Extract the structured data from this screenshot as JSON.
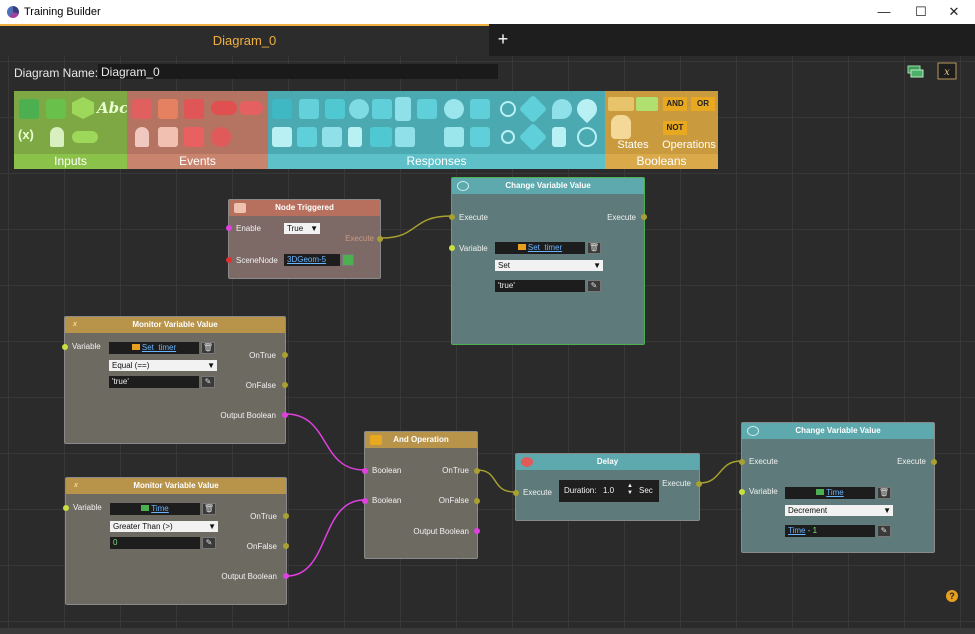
{
  "window": {
    "title": "Training Builder",
    "minimize": "—",
    "maximize": "☐",
    "close": "✕"
  },
  "tabs": [
    {
      "label": "Diagram_0"
    }
  ],
  "add_tab": "+",
  "diagram": {
    "name_label": "Diagram Name:",
    "name_value": "Diagram_0"
  },
  "palette": {
    "inputs": {
      "label": "Inputs",
      "color": "#8bc34a",
      "body": "#7da843"
    },
    "events": {
      "label": "Events",
      "color": "#c9846e",
      "body": "#b57362"
    },
    "responses": {
      "label": "Responses",
      "color": "#5ec0c8",
      "body": "#4aa9b1"
    },
    "booleans": {
      "label": "Booleans",
      "color": "#d9a94a",
      "body": "#c99a3e"
    },
    "states_label": "States",
    "operations_label": "Operations",
    "input_texts": [
      "Abc",
      "(x)"
    ],
    "bool_texts": [
      "AND",
      "OR",
      "NOT"
    ]
  },
  "nodes": {
    "node_triggered": {
      "title": "Node Triggered",
      "enable_label": "Enable",
      "enable_value": "True",
      "scenenode_label": "SceneNode",
      "scenenode_value": "3DGeom-5",
      "execute_out": "Execute"
    },
    "change_var_1": {
      "title": "Change Variable Value",
      "execute_in": "Execute",
      "execute_out": "Execute",
      "variable_label": "Variable",
      "variable_value": "Set_timer",
      "mode": "Set",
      "value": "'true'"
    },
    "monitor_1": {
      "title": "Monitor Variable Value",
      "variable_label": "Variable",
      "variable_value": "Set_timer",
      "compare": "Equal (==)",
      "value": "'true'",
      "on_true": "OnTrue",
      "on_false": "OnFalse",
      "output": "Output Boolean"
    },
    "monitor_2": {
      "title": "Monitor Variable Value",
      "variable_label": "Variable",
      "variable_value": "Time",
      "compare": "Greater Than (>)",
      "value": "0",
      "on_true": "OnTrue",
      "on_false": "OnFalse",
      "output": "Output Boolean"
    },
    "and_op": {
      "title": "And Operation",
      "in1": "Boolean",
      "in2": "Boolean",
      "on_true": "OnTrue",
      "on_false": "OnFalse",
      "output": "Output Boolean"
    },
    "delay": {
      "title": "Delay",
      "execute_in": "Execute",
      "execute_out": "Execute",
      "duration_label": "Duration:",
      "duration_value": "1.0",
      "unit": "Sec"
    },
    "change_var_2": {
      "title": "Change Variable Value",
      "execute_in": "Execute",
      "execute_out": "Execute",
      "variable_label": "Variable",
      "variable_value": "Time",
      "mode": "Decrement",
      "expr_var": "Time",
      "expr_rest": " - 1"
    }
  },
  "help": "?"
}
